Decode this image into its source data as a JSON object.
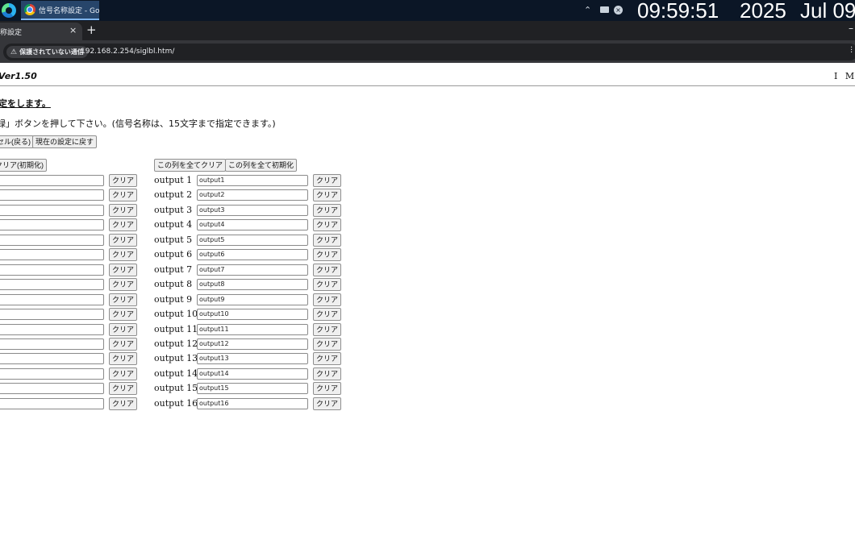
{
  "taskbar": {
    "app_title": "信号名称設定 - Goo...",
    "time": "09:59:51",
    "year": "2025",
    "date": "Jul 09"
  },
  "browser": {
    "tab_title": "称設定",
    "tab_close": "×",
    "new_tab": "+",
    "security_label": "保護されていない通信",
    "url": "192.168.2.254/siglbl.htm/"
  },
  "page": {
    "version": "Ver1.50",
    "brand": "I M A",
    "heading": "定をします。",
    "instruction": "録」ボタンを押して下さい。(信号名称は、15文字まで指定できます。)",
    "cancel_button": "セル(戻る)",
    "restore_button": "現在の設定に戻す",
    "left_col_reset_button": "クリア(初期化)",
    "right_col_clear_all_button": "この列を全てクリア",
    "right_col_reset_button": "この列を全て初期化",
    "clear_label": "クリア"
  },
  "left_inputs": [
    "",
    "",
    "",
    "",
    "",
    "",
    "",
    "",
    "",
    "",
    "",
    "",
    "",
    "",
    "",
    ""
  ],
  "outputs": [
    {
      "label": "output 1",
      "value": "output1"
    },
    {
      "label": "output 2",
      "value": "output2"
    },
    {
      "label": "output 3",
      "value": "output3"
    },
    {
      "label": "output 4",
      "value": "output4"
    },
    {
      "label": "output 5",
      "value": "output5"
    },
    {
      "label": "output 6",
      "value": "output6"
    },
    {
      "label": "output 7",
      "value": "output7"
    },
    {
      "label": "output 8",
      "value": "output8"
    },
    {
      "label": "output 9",
      "value": "output9"
    },
    {
      "label": "output 10",
      "value": "output10"
    },
    {
      "label": "output 11",
      "value": "output11"
    },
    {
      "label": "output 12",
      "value": "output12"
    },
    {
      "label": "output 13",
      "value": "output13"
    },
    {
      "label": "output 14",
      "value": "output14"
    },
    {
      "label": "output 15",
      "value": "output15"
    },
    {
      "label": "output 16",
      "value": "output16"
    }
  ]
}
